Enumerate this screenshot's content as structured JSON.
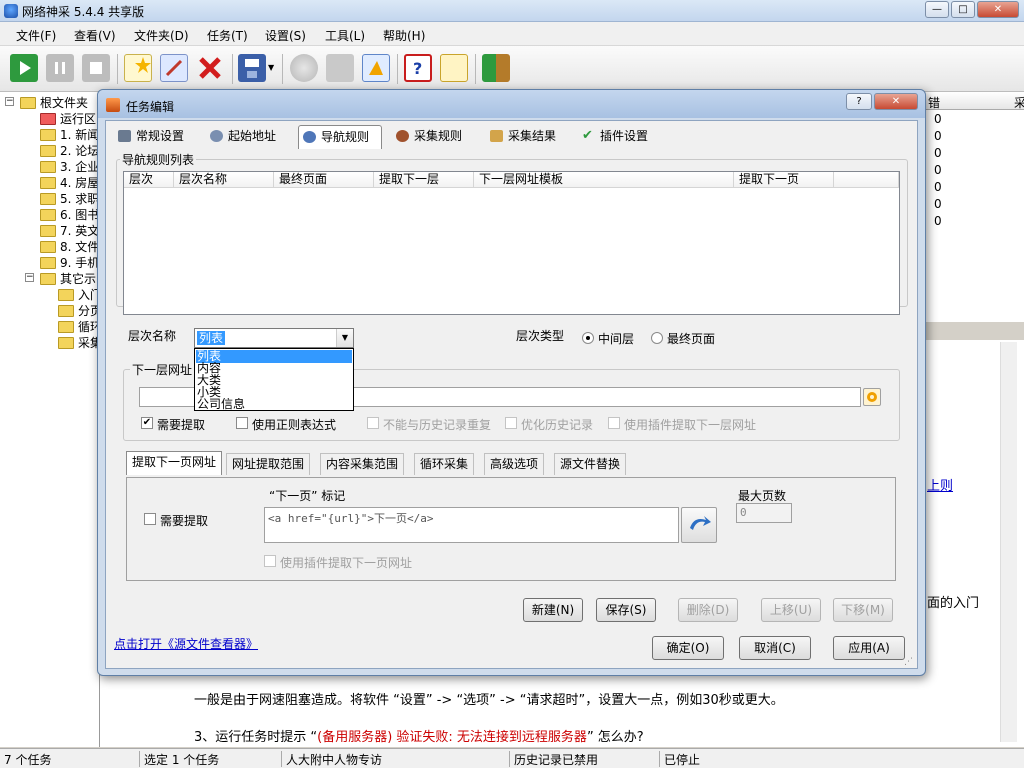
{
  "app": {
    "title": "网络神采 5.4.4 共享版"
  },
  "window_buttons": {
    "minimize": "—",
    "maximize": "□",
    "close": "✕"
  },
  "menu": [
    {
      "label": "文件(F)"
    },
    {
      "label": "查看(V)"
    },
    {
      "label": "文件夹(D)"
    },
    {
      "label": "任务(T)"
    },
    {
      "label": "设置(S)"
    },
    {
      "label": "工具(L)"
    },
    {
      "label": "帮助(H)"
    }
  ],
  "toolbar": {
    "icons": [
      "play-icon",
      "pause-icon",
      "stop-icon",
      "new-task-icon",
      "edit-icon",
      "delete-icon",
      "save-icon",
      "disabled-circle-icon",
      "disabled-gear-icon",
      "plugin-icon",
      "help-icon",
      "search-help-icon",
      "exit-icon"
    ]
  },
  "tree": {
    "root": "根文件夹",
    "items": [
      "运行区",
      "1. 新闻",
      "2. 论坛",
      "3. 企业",
      "4. 房屋",
      "5. 求职",
      "6. 图书",
      "7. 英文",
      "8. 文件",
      "9. 手机"
    ],
    "other": "其它示",
    "other_items": [
      "入门",
      "分页",
      "循环",
      "采集"
    ]
  },
  "grid": {
    "col1": "错",
    "col2": "采",
    "values": [
      "0",
      "0",
      "0",
      "0",
      "0",
      "0",
      "0"
    ]
  },
  "help": {
    "link_fragment": "上则",
    "intro_fragment": "面的入门",
    "line1": "一般是由于网速阻塞造成。将软件 “设置” -> “选项” -> “请求超时”，设置大一点，例如30秒或更大。",
    "line2_prefix": "3、运行任务时提示 “",
    "line2_red": "(备用服务器) 验证失败: 无法连接到远程服务器",
    "line2_suffix": "” 怎么办?"
  },
  "status": {
    "tasks": "7 个任务",
    "selected": "选定 1 个任务",
    "current": "人大附中人物专访",
    "history": "历史记录已禁用",
    "state": "已停止"
  },
  "dialog": {
    "title": "任务编辑",
    "help_btn": "?",
    "close_btn": "✕",
    "tabs": [
      {
        "label": "常规设置"
      },
      {
        "label": "起始地址"
      },
      {
        "label": "导航规则"
      },
      {
        "label": "采集规则"
      },
      {
        "label": "采集结果"
      },
      {
        "label": "插件设置"
      }
    ],
    "nav_group_label": "导航规则列表",
    "columns": [
      "层次",
      "层次名称",
      "最终页面",
      "提取下一层",
      "下一层网址模板",
      "提取下一页"
    ],
    "level_name_label": "层次名称",
    "level_name_value": "列表",
    "level_name_options": [
      "列表",
      "内容",
      "大类",
      "小类",
      "公司信息"
    ],
    "level_type_label": "层次类型",
    "radio_middle": "中间层",
    "radio_final": "最终页面",
    "next_url_group_label": "下一层网址",
    "chk_need_extract": "需要提取",
    "chk_use_regex": "使用正则表达式",
    "chk_no_repeat_history": "不能与历史记录重复",
    "chk_optimize_history": "优化历史记录",
    "chk_use_plugin_next_level": "使用插件提取下一层网址",
    "subtabs": [
      {
        "label": "提取下一页网址"
      },
      {
        "label": "网址提取范围"
      },
      {
        "label": "内容采集范围"
      },
      {
        "label": "循环采集"
      },
      {
        "label": "高级选项"
      },
      {
        "label": "源文件替换"
      }
    ],
    "sub_need_extract": "需要提取",
    "next_page_mark_label": "“下一页” 标记",
    "next_page_mark_value": "<a href=\"{url}\">下一页</a>",
    "max_pages_label": "最大页数",
    "max_pages_value": "0",
    "sub_use_plugin_next_page": "使用插件提取下一页网址",
    "btn_new": "新建(N)",
    "btn_save": "保存(S)",
    "btn_delete": "删除(D)",
    "btn_up": "上移(U)",
    "btn_down": "下移(M)",
    "source_viewer_link": "点击打开《源文件查看器》",
    "btn_ok": "确定(O)",
    "btn_cancel": "取消(C)",
    "btn_apply": "应用(A)"
  },
  "colors": {
    "accent": "#3399ff",
    "link": "#0000cc",
    "warning_red": "#cc0000"
  }
}
